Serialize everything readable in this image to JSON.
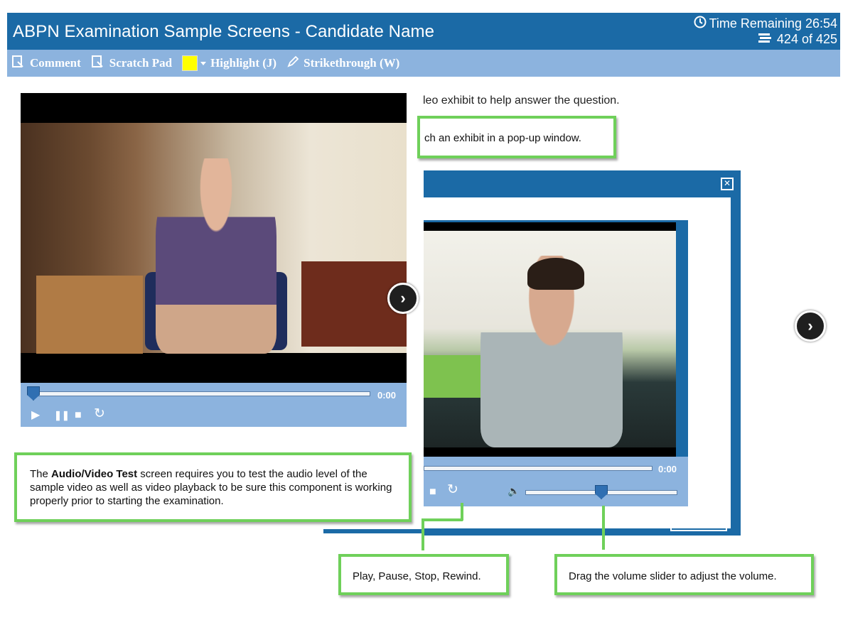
{
  "header": {
    "title": "ABPN Examination Sample Screens - Candidate Name",
    "time_label": "Time Remaining 26:54",
    "progress_label": "424 of 425",
    "time_icon": "clock-icon",
    "progress_icon": "stack-icon",
    "bar_color": "#1b6aa6"
  },
  "toolbar": {
    "comment": "Comment",
    "scratch_pad": "Scratch Pad",
    "highlight": "Highlight (J)",
    "strikethrough": "Strikethrough (W)",
    "highlight_color": "#ffff00",
    "bar_color": "#8cb3de"
  },
  "left_player": {
    "time": "0:00",
    "progress": 0
  },
  "question": {
    "line1": "leo exhibit to help answer the question.",
    "callout_launch": "ch an exhibit in a pop-up window."
  },
  "popup": {
    "time": "0:00",
    "close_label": "Close",
    "volume_level": 0.5
  },
  "callouts": {
    "audio_video_bold": "Audio/Video Test",
    "audio_video_prefix": "The ",
    "audio_video_rest": " screen requires you to test the audio level of the sample video as well as video playback to be sure this component is working properly prior to starting the examination.",
    "controls": "Play, Pause, Stop, Rewind.",
    "volume": "Drag the volume slider to adjust the volume."
  },
  "accent_green": "#6fd05a"
}
